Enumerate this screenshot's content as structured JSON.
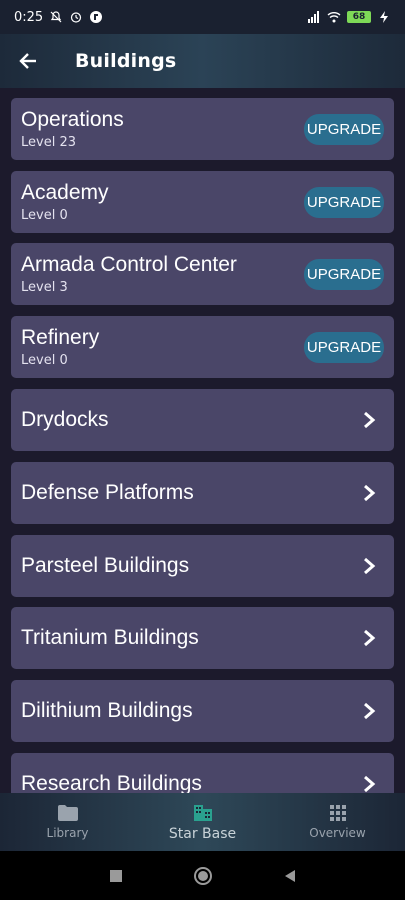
{
  "status": {
    "time": "0:25",
    "battery": "68"
  },
  "header": {
    "title": "Buildings"
  },
  "buildings": [
    {
      "name": "Operations",
      "level": "Level 23",
      "action": "UPGRADE"
    },
    {
      "name": "Academy",
      "level": "Level 0",
      "action": "UPGRADE"
    },
    {
      "name": "Armada Control Center",
      "level": "Level 3",
      "action": "UPGRADE"
    },
    {
      "name": "Refinery",
      "level": "Level 0",
      "action": "UPGRADE"
    }
  ],
  "categories": [
    {
      "name": "Drydocks"
    },
    {
      "name": "Defense Platforms"
    },
    {
      "name": "Parsteel Buildings"
    },
    {
      "name": "Tritanium Buildings"
    },
    {
      "name": "Dilithium Buildings"
    },
    {
      "name": "Research Buildings"
    }
  ],
  "nav": {
    "items": [
      {
        "label": "Library",
        "icon": "folder-icon"
      },
      {
        "label": "Star Base",
        "icon": "buildings-icon",
        "active": true
      },
      {
        "label": "Overview",
        "icon": "grid-icon"
      }
    ]
  },
  "colors": {
    "card": "#4a4668",
    "button": "#2a6e8f",
    "active_nav_icon": "#2aa18f"
  }
}
